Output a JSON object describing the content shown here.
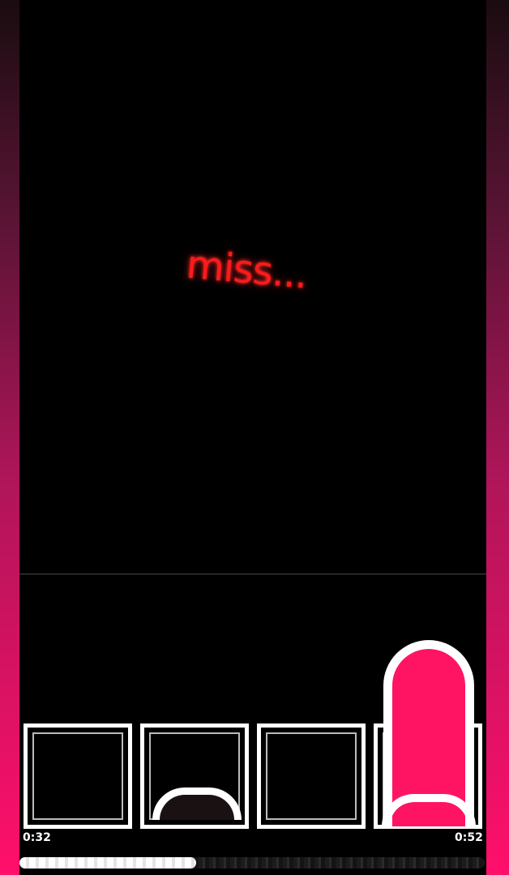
{
  "feedback": {
    "text": "miss..."
  },
  "timer": {
    "elapsed": "0:32",
    "total": "0:52"
  },
  "progress": {
    "fraction": 0.38
  },
  "lanes": [
    {
      "id": 1,
      "state": "empty"
    },
    {
      "id": 2,
      "state": "arc"
    },
    {
      "id": 3,
      "state": "empty"
    },
    {
      "id": 4,
      "state": "pink-note"
    }
  ],
  "colors": {
    "note": "#ff1464",
    "feedback": "#ff1a1a",
    "side_gradient_bottom": "#ff0f6a"
  }
}
